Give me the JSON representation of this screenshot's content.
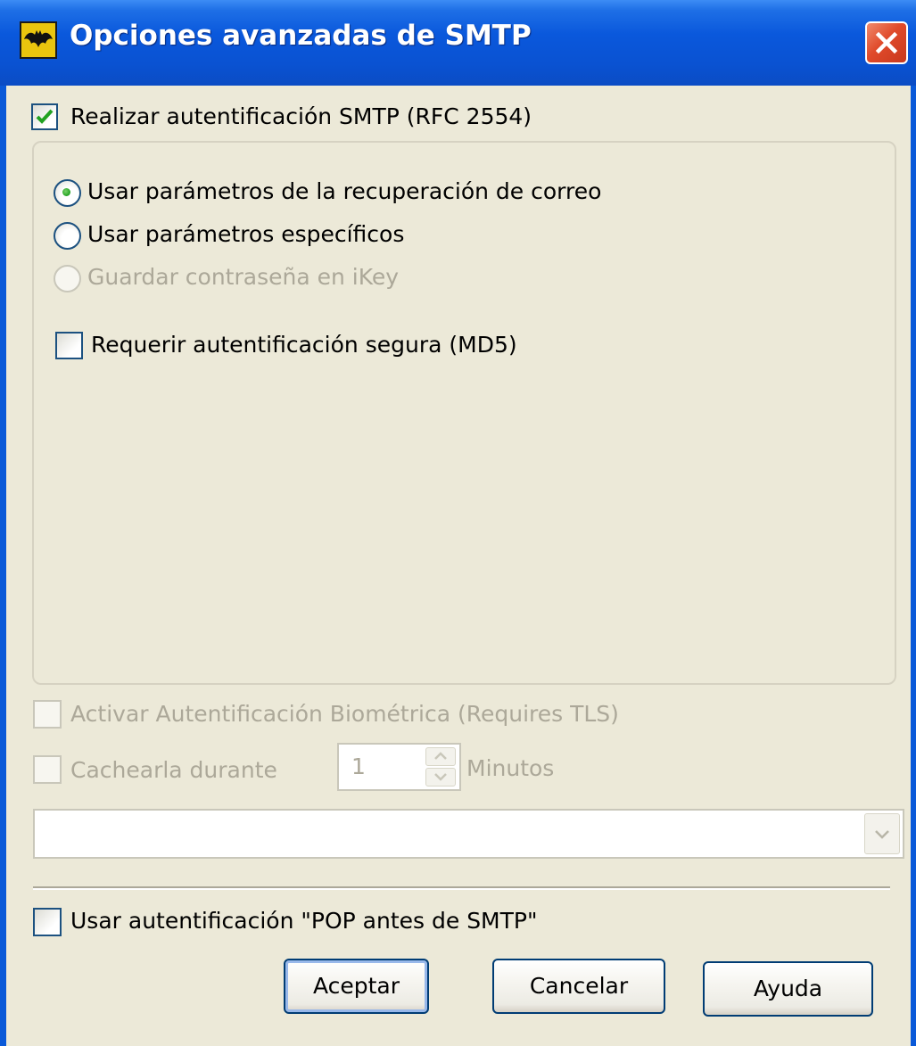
{
  "dialog": {
    "title": "Opciones avanzadas de SMTP",
    "close_icon": "close-icon",
    "app_icon": "bat-app-icon"
  },
  "options": {
    "smtp_auth": {
      "label": "Realizar autentificación SMTP (RFC 2554)",
      "checked": true
    },
    "use_retrieval_params": {
      "label": "Usar parámetros de la recuperación de correo",
      "selected": true
    },
    "use_specific_params": {
      "label": "Usar parámetros específicos",
      "selected": false
    },
    "save_password_ikey": {
      "label": "Guardar contraseña en iKey",
      "selected": false,
      "enabled": false
    },
    "require_secure_auth": {
      "label": "Requerir autentificación segura (MD5)",
      "checked": false
    },
    "biometric_auth": {
      "label": "Activar Autentificación Biométrica (Requires TLS)",
      "checked": false,
      "enabled": false
    },
    "cache_for": {
      "label": "Cachearla durante",
      "checked": false,
      "enabled": false,
      "value": "1",
      "unit": "Minutos"
    },
    "device_combo": {
      "value": "",
      "enabled": false
    },
    "pop_before_smtp": {
      "label": "Usar autentificación \"POP antes de SMTP\"",
      "checked": false
    }
  },
  "buttons": {
    "ok": "Aceptar",
    "cancel": "Cancelar",
    "help": "Ayuda"
  },
  "colors": {
    "titlebar": "#0a58dc",
    "dialog_bg": "#ece9d8",
    "check_green": "#21a121",
    "disabled_text": "#aca899"
  }
}
